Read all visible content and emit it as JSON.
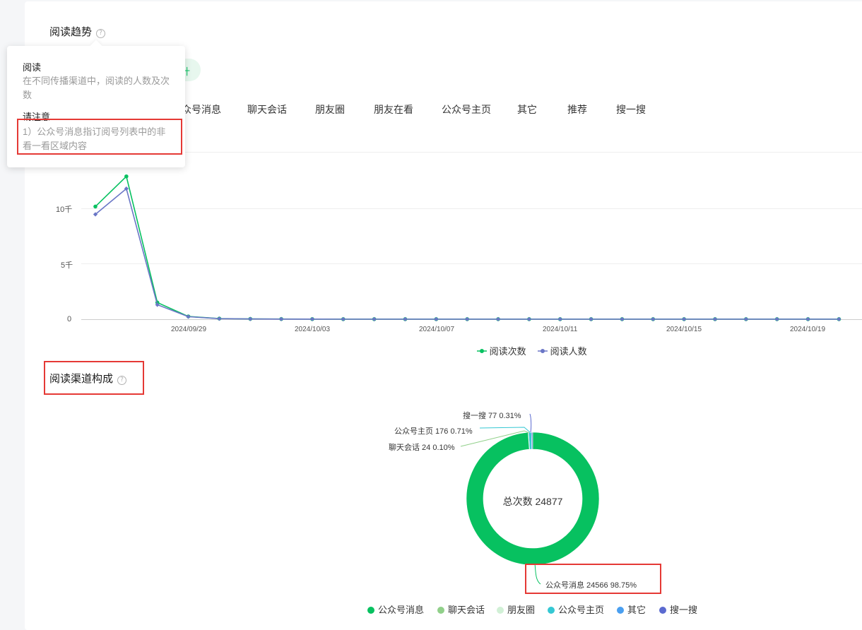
{
  "trend": {
    "title": "阅读趋势",
    "help_glyph": "?"
  },
  "filter_pill": {
    "label": "计"
  },
  "tabs": [
    "众号消息",
    "聊天会话",
    "朋友圈",
    "朋友在看",
    "公众号主页",
    "其它",
    "推荐",
    "搜一搜"
  ],
  "tooltip": {
    "title1": "阅读",
    "desc1": "在不同传播渠道中，阅读的人数及次数",
    "title2": "请注意",
    "desc2": "1）公众号消息指订阅号列表中的非看一看区域内容"
  },
  "line_chart": {
    "type": "line",
    "y_ticks": [
      "10千",
      "5千",
      "0"
    ],
    "x_ticks": [
      "2024/09/29",
      "2024/10/03",
      "2024/10/07",
      "2024/10/11",
      "2024/10/15",
      "2024/10/19"
    ],
    "ylim": [
      0,
      15000
    ],
    "series": [
      {
        "name": "阅读次数",
        "color": "#07c160",
        "values": [
          10100,
          12800,
          1500,
          250,
          60,
          30,
          20,
          15,
          10,
          10,
          10,
          10,
          10,
          10,
          10,
          10,
          10,
          10,
          10,
          10,
          10,
          10,
          10,
          10,
          10
        ]
      },
      {
        "name": "阅读人数",
        "color": "#6a76c6",
        "values": [
          9400,
          11700,
          1300,
          230,
          50,
          25,
          15,
          12,
          8,
          8,
          8,
          8,
          8,
          8,
          8,
          8,
          8,
          8,
          8,
          8,
          8,
          8,
          8,
          8,
          8
        ]
      }
    ]
  },
  "legend_top": [
    "阅读次数",
    "阅读人数"
  ],
  "channel": {
    "title": "阅读渠道构成",
    "help_glyph": "?"
  },
  "chart_data": {
    "type": "pie",
    "center_label": "总次数 24877",
    "slices": [
      {
        "name": "公众号消息",
        "value": 24566,
        "percent": "98.75%",
        "label": "公众号消息 24566 98.75%",
        "color": "#07c160"
      },
      {
        "name": "聊天会话",
        "value": 24,
        "percent": "0.10%",
        "label": "聊天会话 24 0.10%",
        "color": "#91d08a"
      },
      {
        "name": "朋友圈",
        "value": 0,
        "percent": "0%",
        "label": "",
        "color": "#d1f0d6"
      },
      {
        "name": "公众号主页",
        "value": 176,
        "percent": "0.71%",
        "label": "公众号主页 176 0.71%",
        "color": "#35c8d3"
      },
      {
        "name": "其它",
        "value": 0,
        "percent": "0%",
        "label": "",
        "color": "#4a9ff0"
      },
      {
        "name": "搜一搜",
        "value": 77,
        "percent": "0.31%",
        "label": "搜一搜 77 0.31%",
        "color": "#5b6ad0"
      }
    ]
  },
  "legend_bottom": [
    {
      "label": "公众号消息",
      "color": "#07c160"
    },
    {
      "label": "聊天会话",
      "color": "#91d08a"
    },
    {
      "label": "朋友圈",
      "color": "#d1f0d6"
    },
    {
      "label": "公众号主页",
      "color": "#35c8d3"
    },
    {
      "label": "其它",
      "color": "#4a9ff0"
    },
    {
      "label": "搜一搜",
      "color": "#5b6ad0"
    }
  ]
}
